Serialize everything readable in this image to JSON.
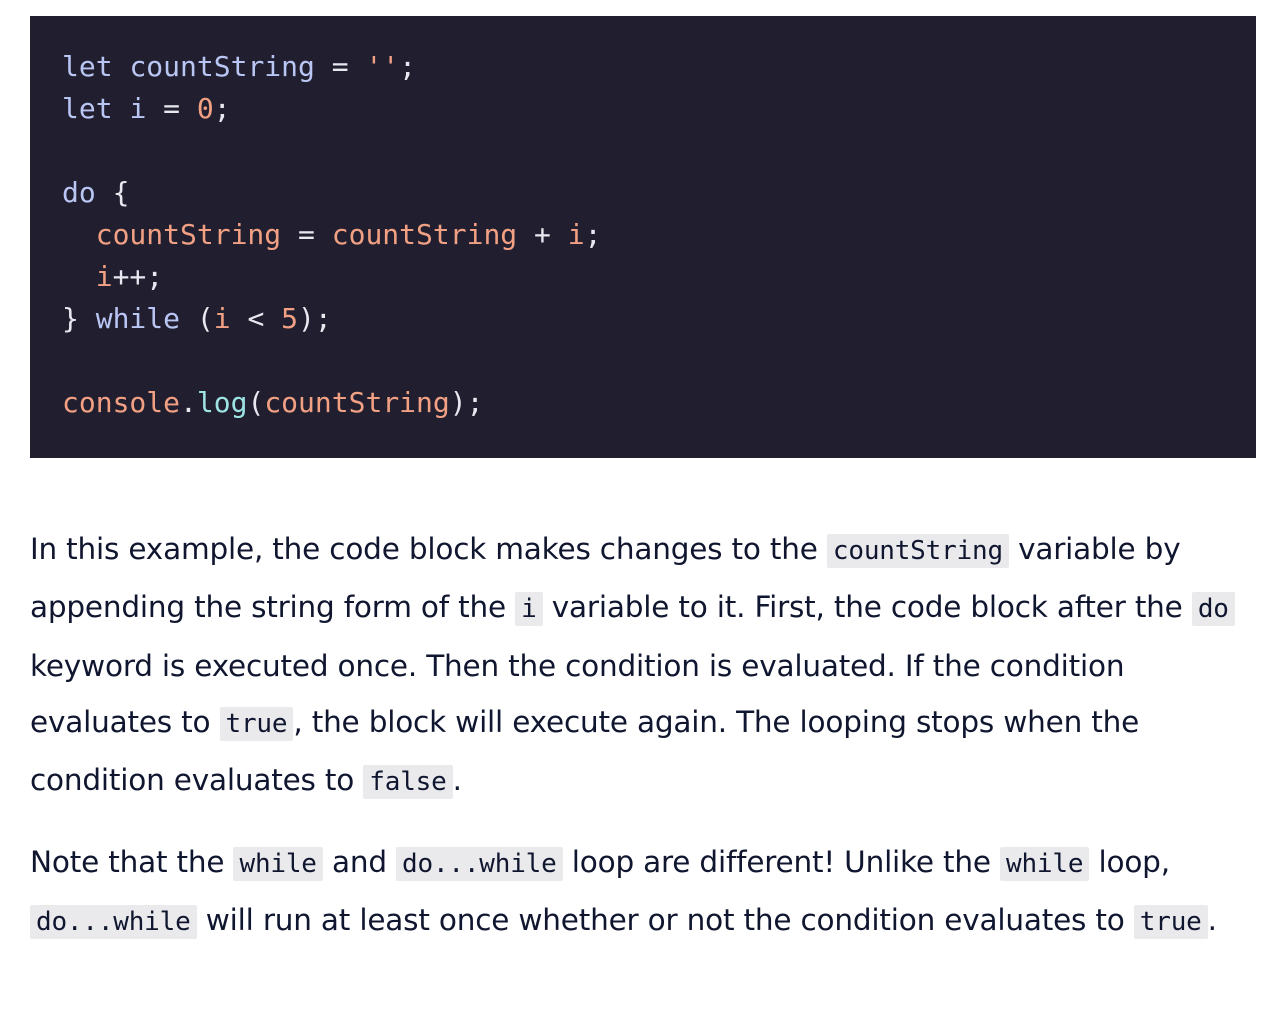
{
  "code": {
    "language": "javascript",
    "lines": [
      "let countString = '';",
      "let i = 0;",
      "",
      "do {",
      "  countString = countString + i;",
      "  i++;",
      "} while (i < 5);",
      "",
      "console.log(countString);"
    ]
  },
  "paragraph1": {
    "t1": "In this example, the code block makes changes to the ",
    "c1": "countString",
    "t2": " variable by appending the string form of the ",
    "c2": "i",
    "t3": " variable to it. First, the code block after the ",
    "c3": "do",
    "t4": " keyword is executed once. Then the condition is evaluated. If the condition evaluates to ",
    "c4": "true",
    "t5": ", the block will execute again. The looping stops when the condition evaluates to ",
    "c5": "false",
    "t6": "."
  },
  "paragraph2": {
    "t1": "Note that the ",
    "c1": "while",
    "t2": " and ",
    "c2": "do...while",
    "t3": " loop are different! Unlike the ",
    "c3": "while",
    "t4": " loop, ",
    "c4": "do...while",
    "t5": " will run at least once whether or not the condition evaluates to ",
    "c5": "true",
    "t6": "."
  },
  "colors": {
    "code_background": "#211f2f",
    "keyword": "#b9c6f4",
    "string_number": "#f2a083",
    "function": "#9ee3e3",
    "text": "#10162f",
    "inline_code_background": "#eaeaec"
  }
}
